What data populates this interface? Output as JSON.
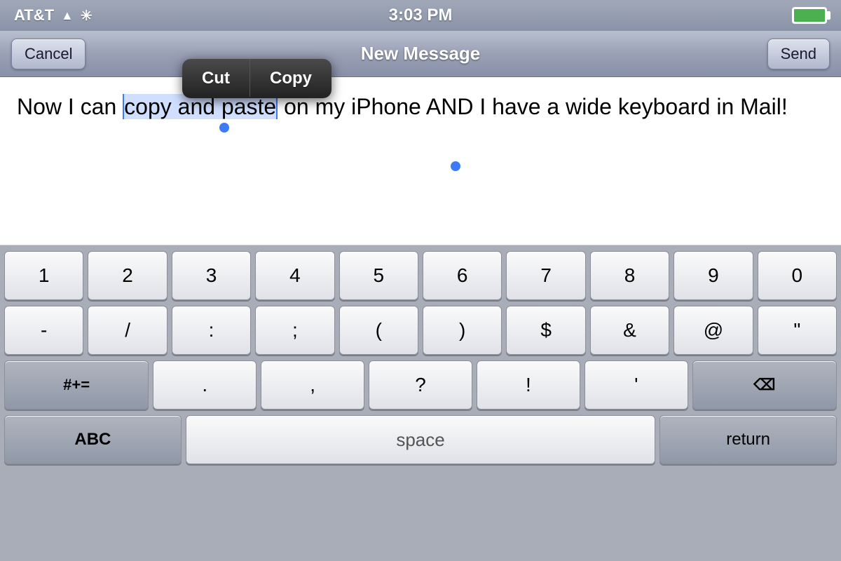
{
  "statusBar": {
    "carrier": "AT&T",
    "time": "3:03 PM",
    "batteryFull": true
  },
  "navBar": {
    "cancelLabel": "Cancel",
    "title": "New Message",
    "sendLabel": "Send"
  },
  "contextMenu": {
    "cutLabel": "Cut",
    "copyLabel": "Copy"
  },
  "messageArea": {
    "text": "Now I can copy and paste on my iPhone AND I have a wide keyboard in Mail!",
    "selectedText": "copy and paste"
  },
  "keyboard": {
    "row1": [
      "1",
      "2",
      "3",
      "4",
      "5",
      "6",
      "7",
      "8",
      "9",
      "0"
    ],
    "row2": [
      "-",
      "/",
      ":",
      ";",
      "(",
      ")",
      "$",
      "&",
      "@",
      "\""
    ],
    "row3Left": "#+=",
    "row3Middle": [
      ".",
      ",",
      "?",
      "!",
      "'"
    ],
    "row3Right": "⌫",
    "row4Left": "ABC",
    "row4Middle": "space",
    "row4Right": "return"
  }
}
